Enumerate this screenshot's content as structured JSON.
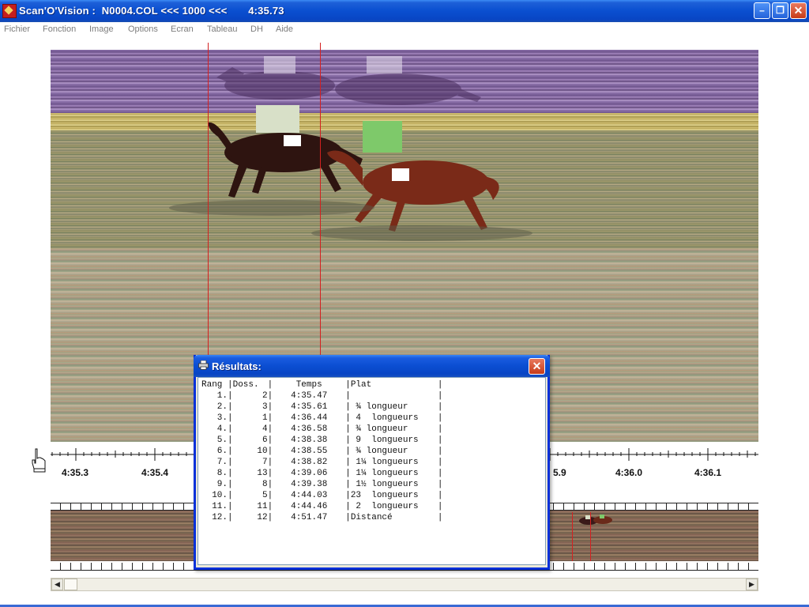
{
  "window": {
    "title": "Scan'O'Vision :  N0004.COL <<< 1000 <<<       4:35.73",
    "minimize": "–",
    "restore": "❐",
    "close": "✕"
  },
  "menu": [
    "Fichier",
    "Fonction",
    "Image",
    "Options",
    "Ecran",
    "Tableau",
    "DH",
    "Aide"
  ],
  "timeline": {
    "labels": [
      "4:35.3",
      "4:35.4",
      "5.9",
      "4:36.0",
      "4:36.1"
    ]
  },
  "dialog": {
    "title": "Résultats:",
    "close": "✕",
    "headers": {
      "rang": "Rang",
      "doss": "Doss.",
      "temps": "Temps",
      "plat": "Plat"
    },
    "rows": [
      {
        "rang": "1.",
        "doss": "2",
        "temps": "4:35.47",
        "plat": ""
      },
      {
        "rang": "2.",
        "doss": "3",
        "temps": "4:35.61",
        "plat": " ¾ longueur"
      },
      {
        "rang": "3.",
        "doss": "1",
        "temps": "4:36.44",
        "plat": " 4  longueurs"
      },
      {
        "rang": "4.",
        "doss": "4",
        "temps": "4:36.58",
        "plat": " ¾ longueur"
      },
      {
        "rang": "5.",
        "doss": "6",
        "temps": "4:38.38",
        "plat": " 9  longueurs"
      },
      {
        "rang": "6.",
        "doss": "10",
        "temps": "4:38.55",
        "plat": " ¾ longueur"
      },
      {
        "rang": "7.",
        "doss": "7",
        "temps": "4:38.82",
        "plat": " 1¼ longueurs"
      },
      {
        "rang": "8.",
        "doss": "13",
        "temps": "4:39.06",
        "plat": " 1¼ longueurs"
      },
      {
        "rang": "9.",
        "doss": "8",
        "temps": "4:39.38",
        "plat": " 1½ longueurs"
      },
      {
        "rang": "10.",
        "doss": "5",
        "temps": "4:44.03",
        "plat": "23  longueurs"
      },
      {
        "rang": "11.",
        "doss": "11",
        "temps": "4:44.46",
        "plat": " 2  longueurs"
      },
      {
        "rang": "12.",
        "doss": "12",
        "temps": "4:51.47",
        "plat": "Distancé"
      }
    ]
  },
  "scroll": {
    "left": "◀",
    "right": "▶"
  }
}
